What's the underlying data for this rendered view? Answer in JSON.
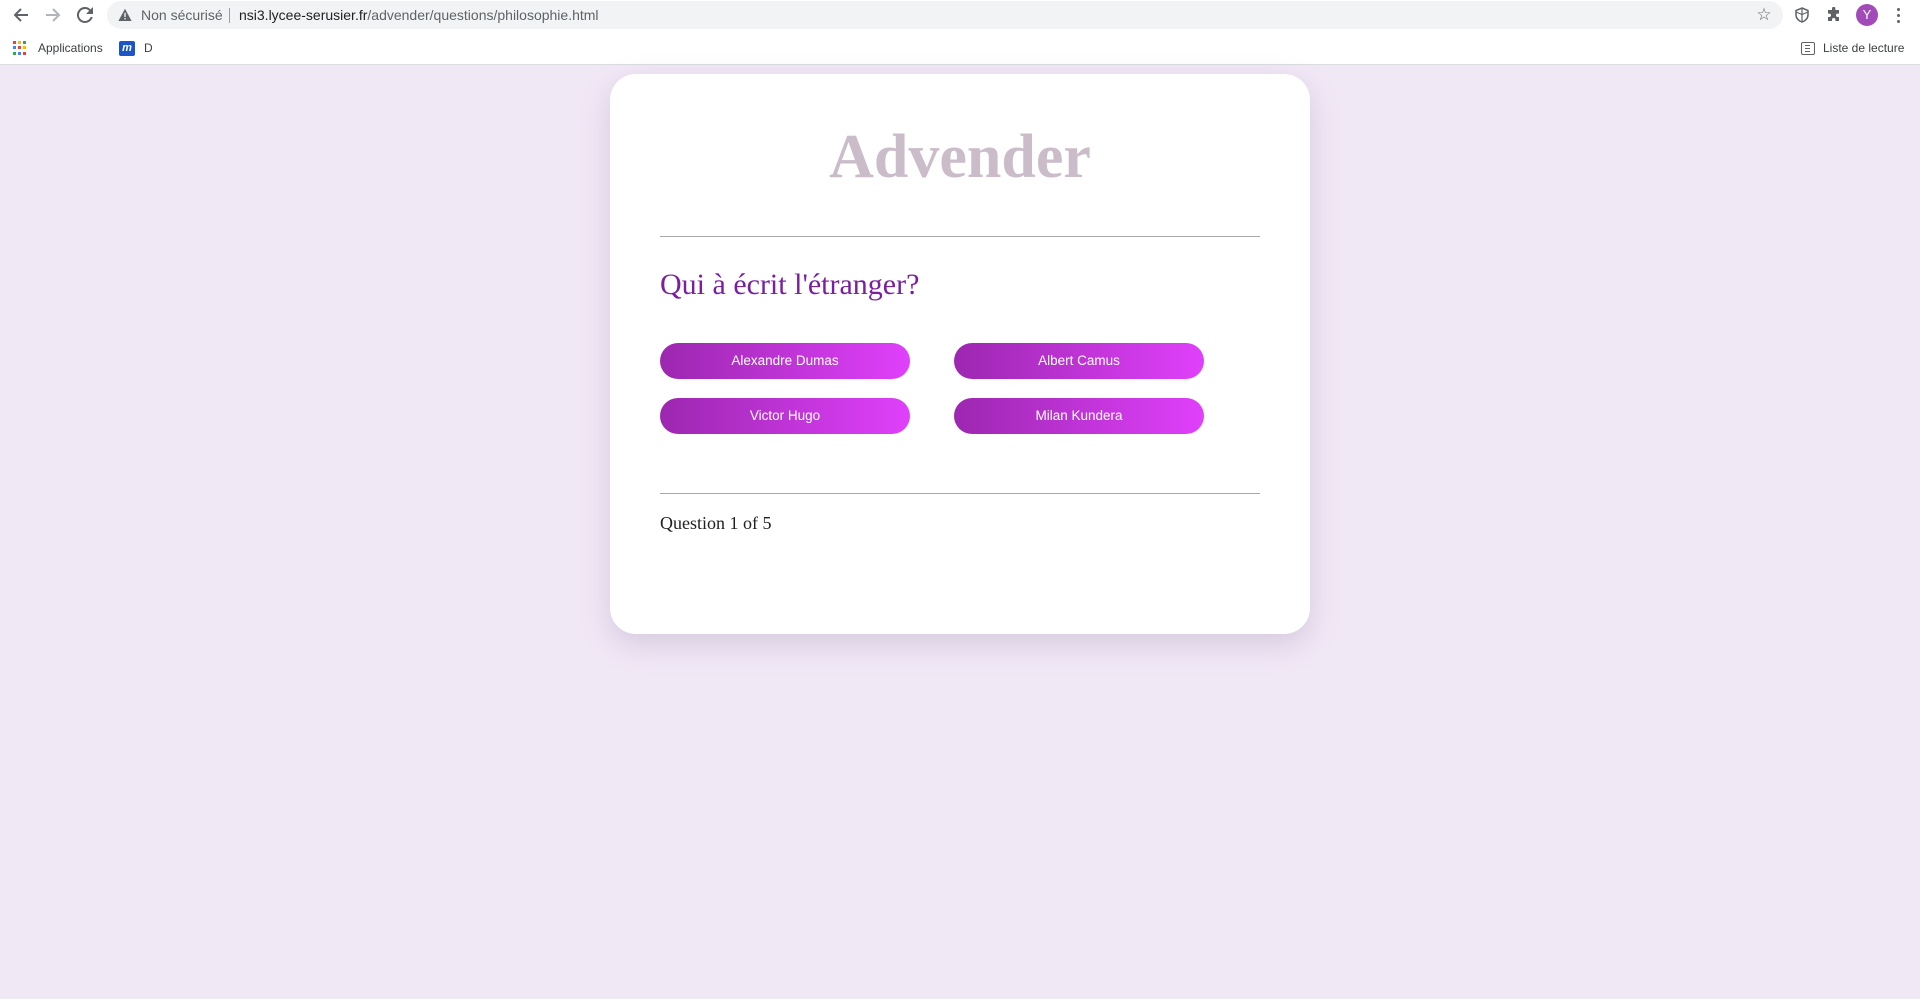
{
  "browser": {
    "security_label": "Non sécurisé",
    "url_host": "nsi3.lycee-serusier.fr",
    "url_path": "/advender/questions/philosophie.html",
    "avatar_initial": "Y",
    "icons": [
      "back-arrow-icon",
      "forward-arrow-icon",
      "reload-icon",
      "warning-icon",
      "star-icon",
      "extension-shield-icon",
      "puzzle-icon",
      "kebab-menu-icon"
    ]
  },
  "bookmarks": {
    "apps_label": "Applications",
    "d_label": "D",
    "m_logo": "m",
    "reading_list_label": "Liste de lecture"
  },
  "quiz": {
    "brand": "Advender",
    "question": "Qui à écrit l'étranger?",
    "answers": [
      "Alexandre Dumas",
      "Albert Camus",
      "Victor Hugo",
      "Milan Kundera"
    ],
    "progress": "Question 1 of 5"
  },
  "colors": {
    "page_background": "#f1e8f6",
    "brand_text": "#cbbcca",
    "question_text": "#7b1fa2",
    "button_gradient_start": "#9c27b0",
    "button_gradient_end": "#e040fb"
  }
}
